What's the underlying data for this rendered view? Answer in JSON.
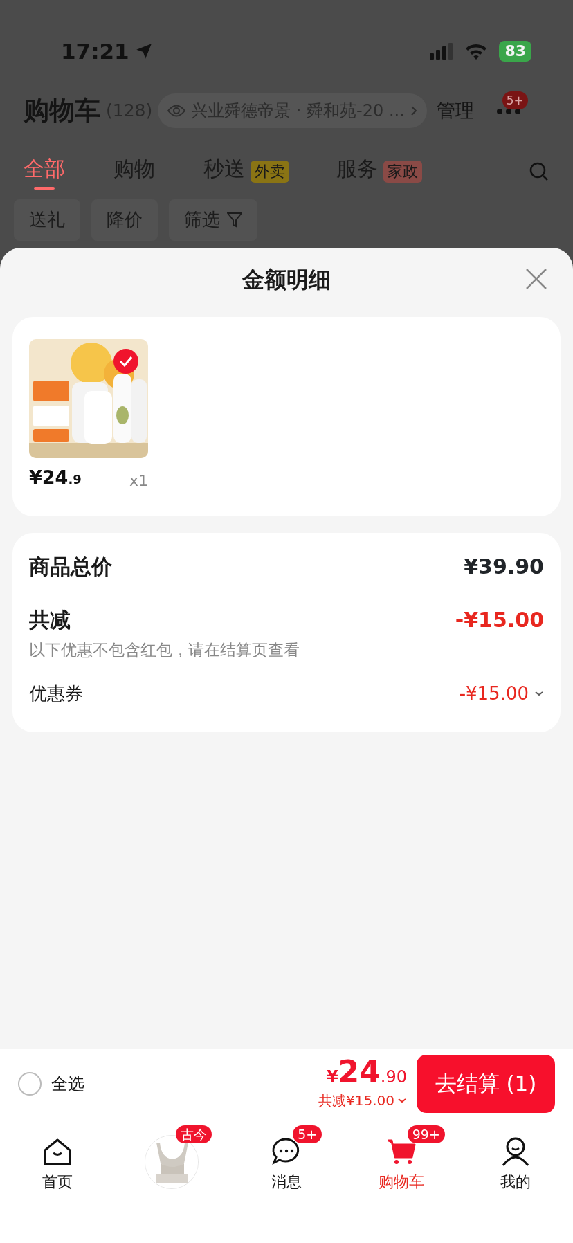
{
  "status_bar": {
    "time": "17:21",
    "battery": "83"
  },
  "header": {
    "title": "购物车",
    "count": "(128)",
    "address": "兴业舜德帝景 · 舜和苑-20 ...",
    "manage": "管理",
    "more_badge": "5+"
  },
  "tabs": [
    {
      "label": "全部",
      "selected": true
    },
    {
      "label": "购物",
      "selected": false
    },
    {
      "label": "秒送",
      "tag": "外卖",
      "color": "#8a7414",
      "selected": false
    },
    {
      "label": "服务",
      "tag": "家政",
      "color": "#8a4a46",
      "selected": false
    }
  ],
  "filters": [
    {
      "label": "送礼",
      "kind": "plain"
    },
    {
      "label": "降价",
      "kind": "plain"
    },
    {
      "label": "筛选",
      "kind": "funnel"
    }
  ],
  "sheet": {
    "title": "金额明细",
    "items": [
      {
        "kind": "picture",
        "price": "¥24",
        "price_decimal": ".9",
        "quantity": "x1",
        "selected": true
      }
    ],
    "total_label": "商品总价",
    "total_value": "¥39.90",
    "discount_label": "共减",
    "discount_value": "-¥15.00",
    "discount_note": "以下优惠不包含红包，请在结算页查看",
    "coupon_label": "优惠券",
    "coupon_value": "-¥15.00"
  },
  "checkout": {
    "select_all": "全选",
    "checked": false,
    "currency": "¥",
    "price": "24",
    "price_decimal": ".90",
    "saved": "共减¥15.00",
    "button": "去结算 (1)"
  },
  "nav": [
    {
      "kind": "home",
      "label": "首页",
      "selected": false
    },
    {
      "kind": "promo",
      "badge": "古今"
    },
    {
      "kind": "chat",
      "label": "消息",
      "badge": "5+",
      "selected": false
    },
    {
      "kind": "cart",
      "label": "购物车",
      "badge": "99+",
      "selected": true
    },
    {
      "kind": "user",
      "label": "我的",
      "selected": false
    }
  ]
}
